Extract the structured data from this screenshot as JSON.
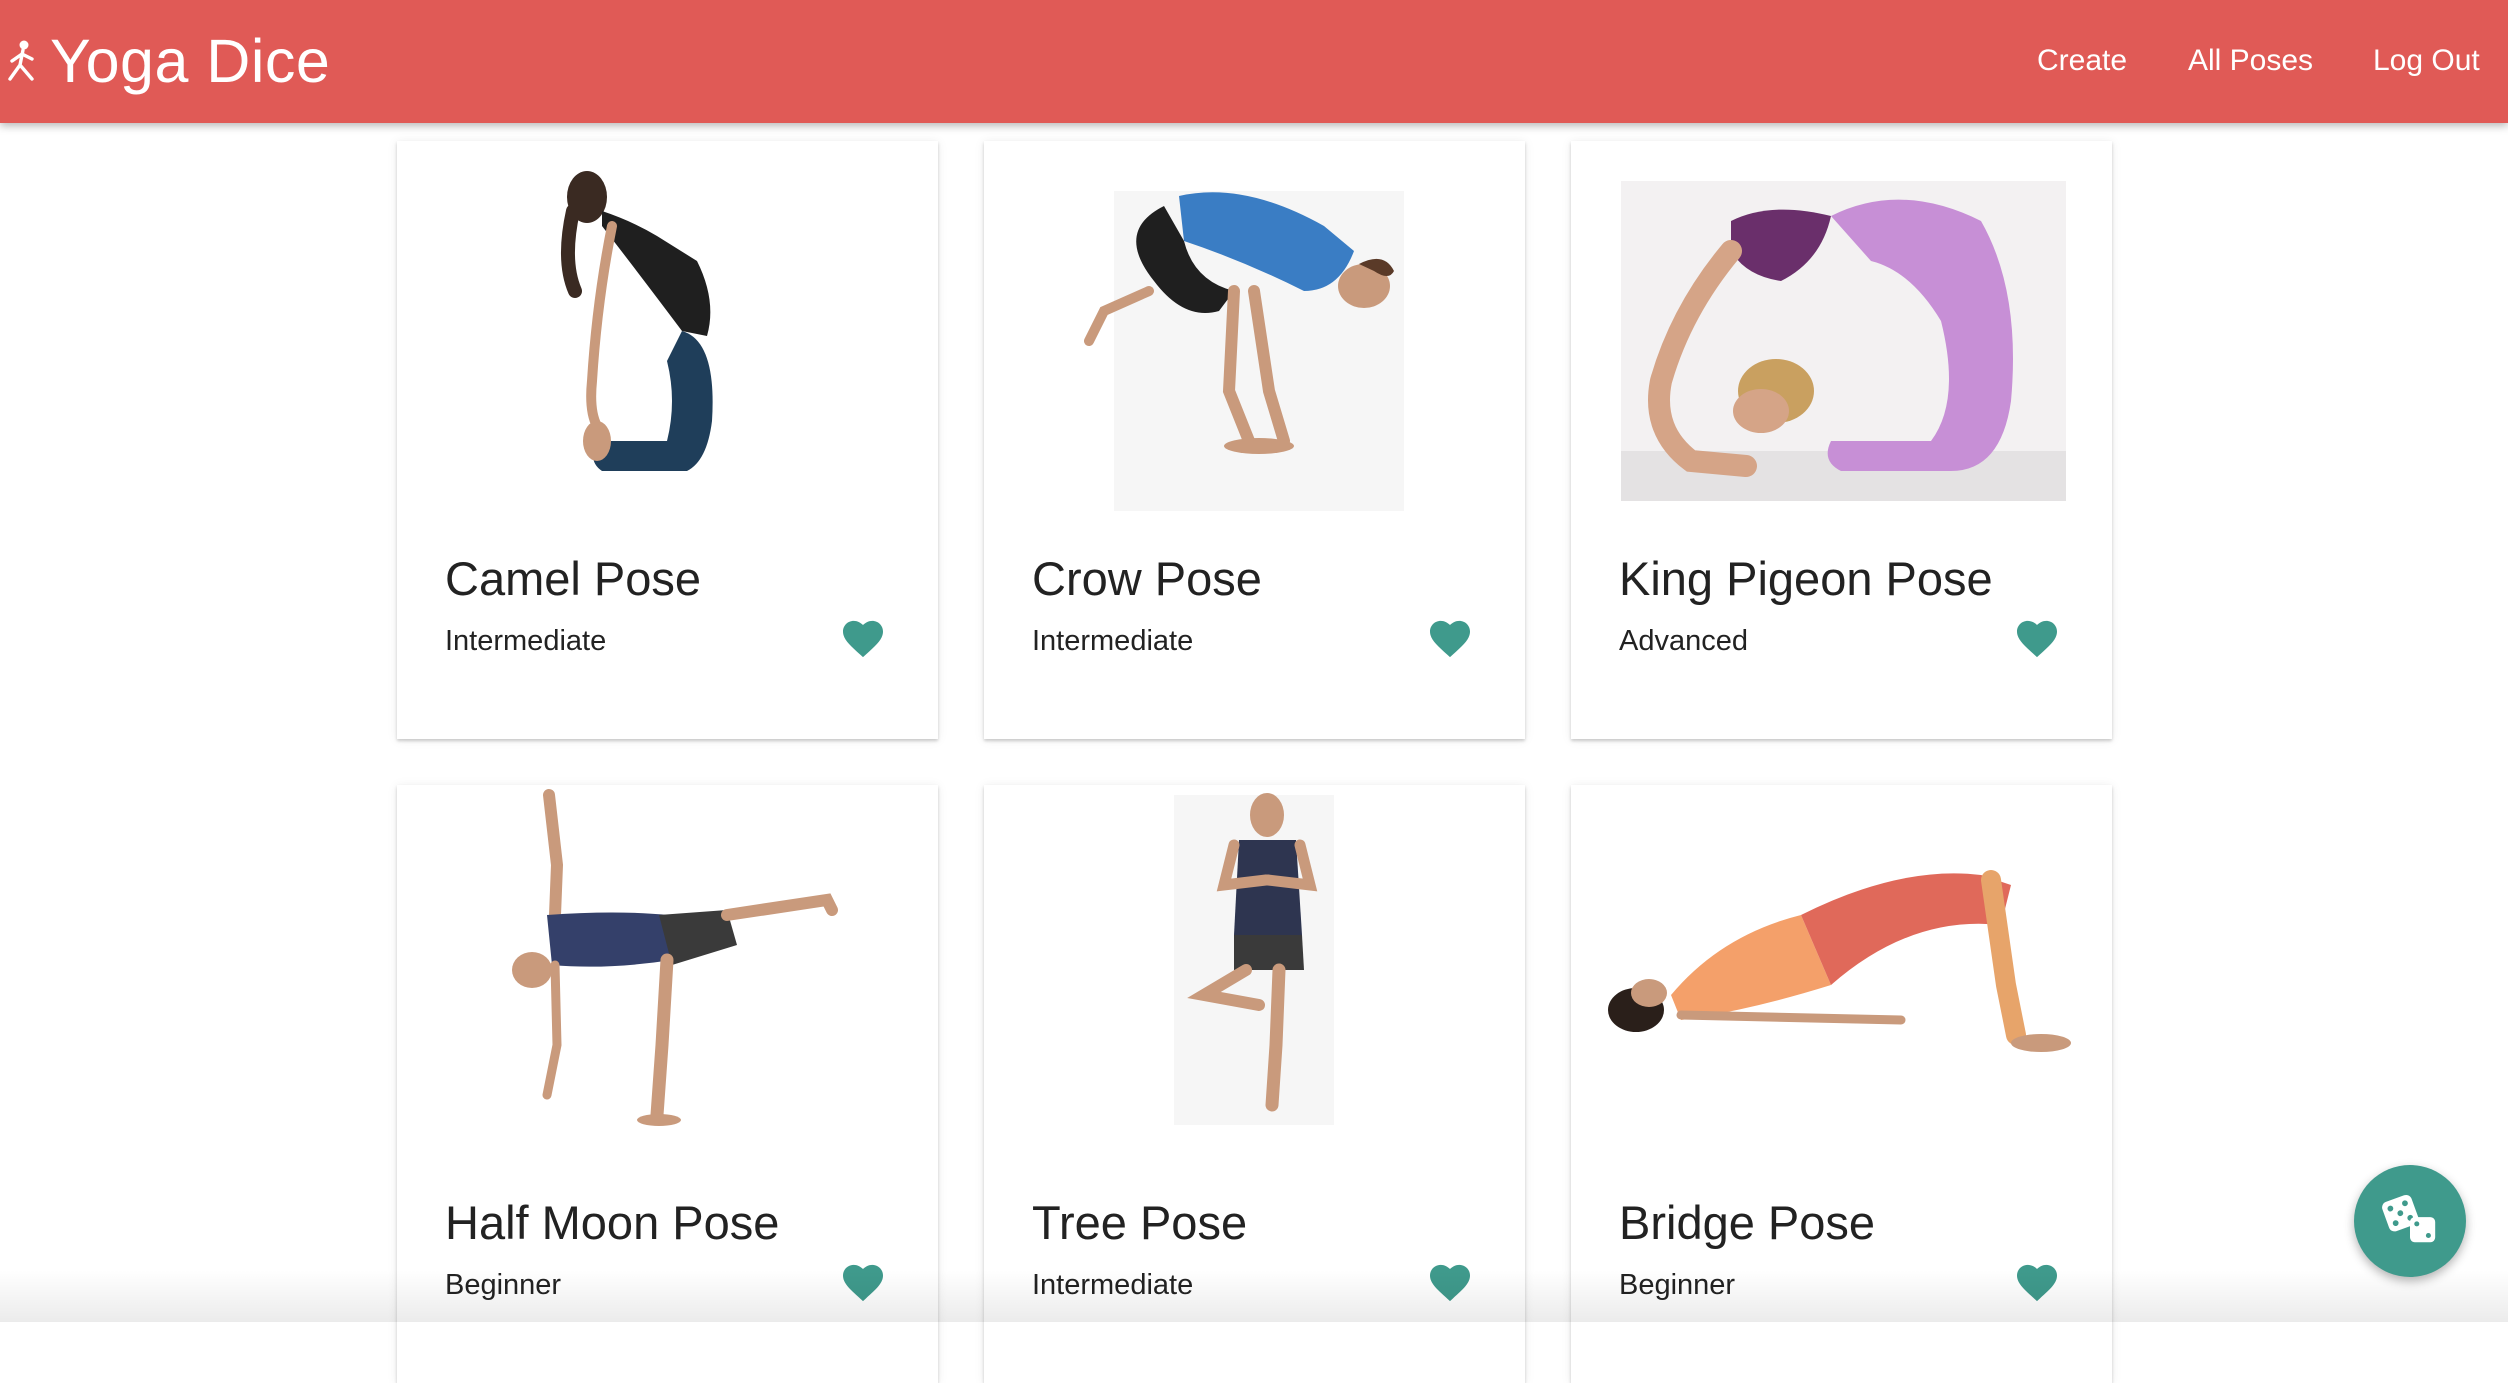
{
  "app": {
    "brand_name": "Yoga Dice",
    "brand_icon": "yoga-figure-icon",
    "brand_color": "#e05a56",
    "accent_color": "#3f9a8c"
  },
  "nav": {
    "create": "Create",
    "all_poses": "All Poses",
    "log_out": "Log Out"
  },
  "poses": [
    {
      "name": "Camel Pose",
      "level": "Intermediate",
      "favorite_icon": "heart-icon",
      "image": "camel-pose-photo"
    },
    {
      "name": "Crow Pose",
      "level": "Intermediate",
      "favorite_icon": "heart-icon",
      "image": "crow-pose-photo"
    },
    {
      "name": "King Pigeon Pose",
      "level": "Advanced",
      "favorite_icon": "heart-icon",
      "image": "king-pigeon-pose-photo"
    },
    {
      "name": "Half Moon Pose",
      "level": "Beginner",
      "favorite_icon": "heart-icon",
      "image": "half-moon-pose-photo"
    },
    {
      "name": "Tree Pose",
      "level": "Intermediate",
      "favorite_icon": "heart-icon",
      "image": "tree-pose-photo"
    },
    {
      "name": "Bridge Pose",
      "level": "Beginner",
      "favorite_icon": "heart-icon",
      "image": "bridge-pose-photo"
    }
  ],
  "fab": {
    "icon": "dice-icon"
  }
}
